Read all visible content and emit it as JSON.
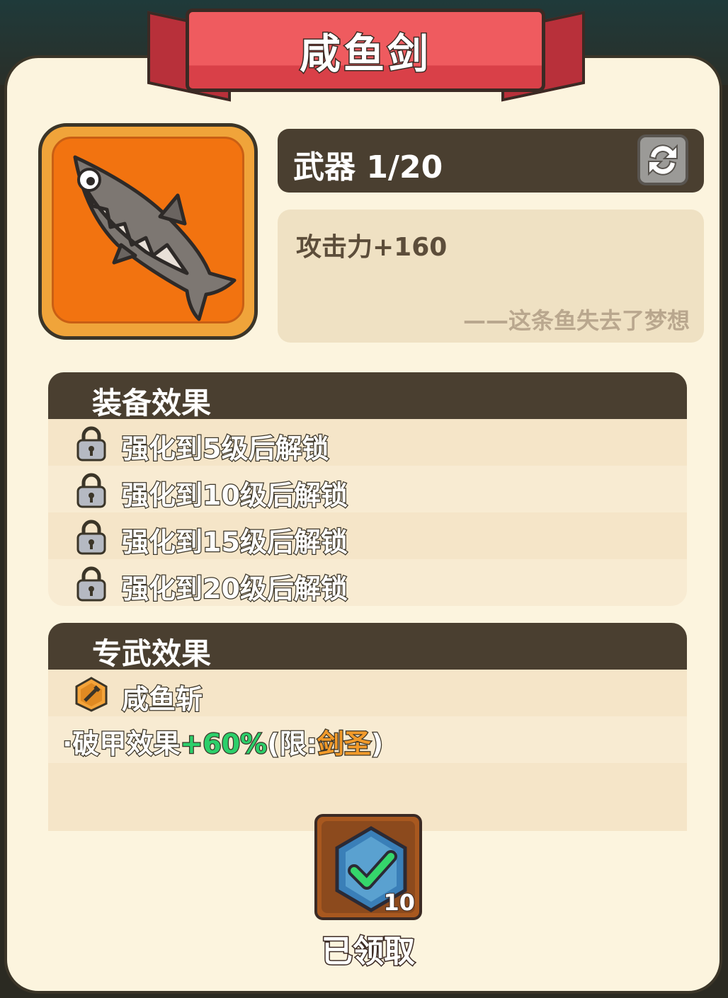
{
  "title": "咸鱼剑",
  "weapon": {
    "icon": "salted-fish-sword-icon",
    "type_label": "武器 1/20",
    "stat": "攻击力+160",
    "quote": "——这条鱼失去了梦想"
  },
  "equip_effects": {
    "header": "装备效果",
    "items": [
      {
        "label": "强化到5级后解锁",
        "icon": "lock-icon"
      },
      {
        "label": "强化到10级后解锁",
        "icon": "lock-icon"
      },
      {
        "label": "强化到15级后解锁",
        "icon": "lock-icon"
      },
      {
        "label": "强化到20级后解锁",
        "icon": "lock-icon"
      }
    ]
  },
  "exclusive_effects": {
    "header": "专武效果",
    "skill_name": "咸鱼斩",
    "skill_icon": "hex-sword-icon",
    "effect_prefix": "·破甲效果",
    "effect_value": "+60%",
    "effect_restrict_open": "(限:",
    "effect_restrict_class": "剑圣",
    "effect_restrict_close": ")"
  },
  "reward": {
    "icon": "hexagon-check-icon",
    "count": "10",
    "status": "已领取"
  },
  "colors": {
    "ribbon": "#ef5b5f",
    "panel": "#fcf4de",
    "header_bar": "#4a3f30",
    "icon_bg": "#f27310",
    "green_value": "#2ccf6a",
    "orange_value": "#f29a2a"
  }
}
